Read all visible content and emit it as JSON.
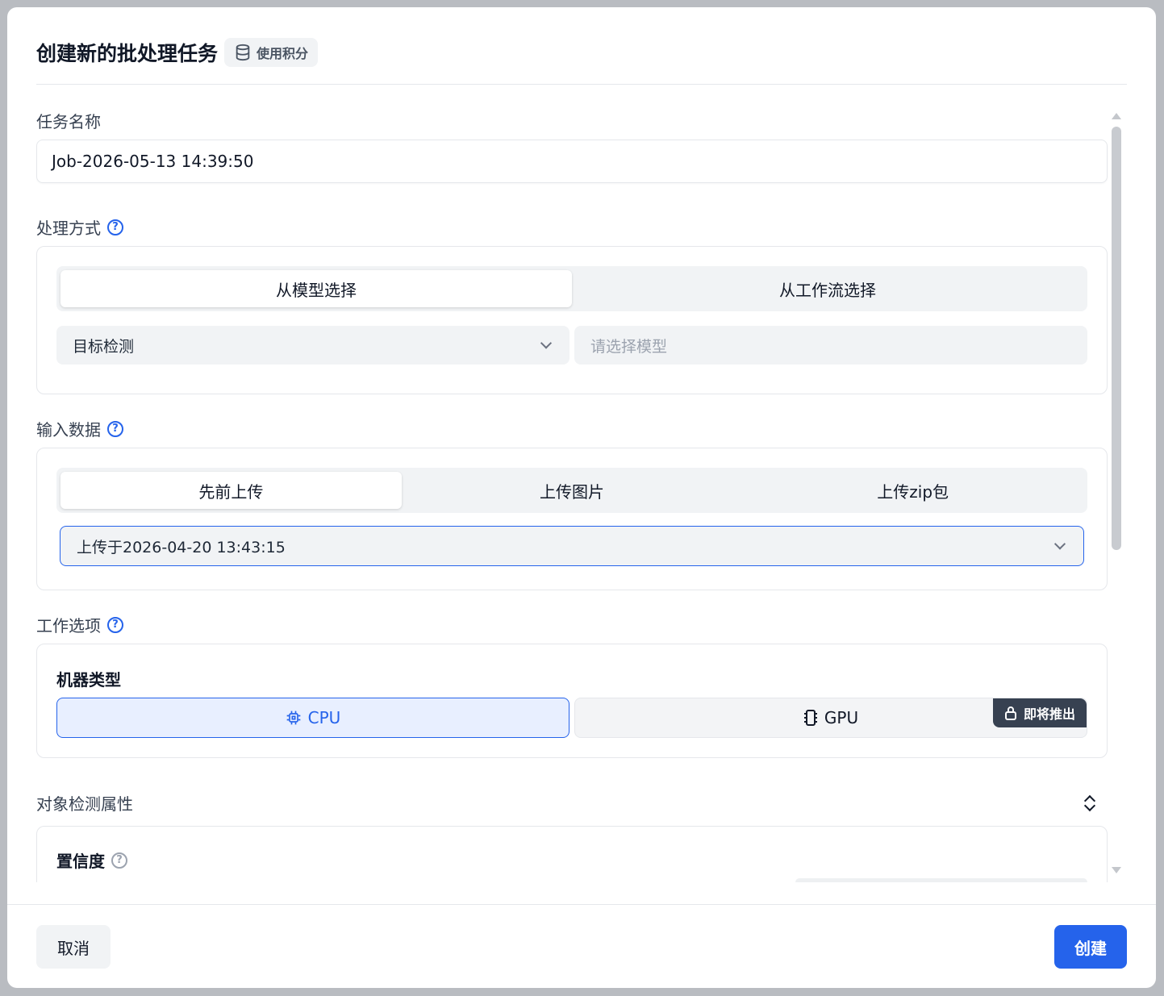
{
  "header": {
    "title": "创建新的批处理任务",
    "credit_badge": "使用积分",
    "credit_icon": "database-icon"
  },
  "task_name": {
    "label": "任务名称",
    "value": "Job-2026-05-13 14:39:50"
  },
  "processing": {
    "label": "处理方式",
    "tabs": [
      "从模型选择",
      "从工作流选择"
    ],
    "active_tab": 0,
    "category_select": "目标检测",
    "model_placeholder": "请选择模型"
  },
  "input_data": {
    "label": "输入数据",
    "tabs": [
      "先前上传",
      "上传图片",
      "上传zip包"
    ],
    "active_tab": 0,
    "upload_select": "上传于2026-04-20 13:43:15"
  },
  "work_options": {
    "label": "工作选项",
    "machine_type_label": "机器类型",
    "cpu_label": "CPU",
    "gpu_label": "GPU",
    "gpu_badge": "即将推出"
  },
  "detection": {
    "label": "对象检测属性",
    "confidence_label": "置信度"
  },
  "footer": {
    "cancel": "取消",
    "create": "创建"
  },
  "colors": {
    "accent": "#2563eb",
    "muted_bg": "#f1f3f5",
    "badge_dark": "#374151"
  }
}
